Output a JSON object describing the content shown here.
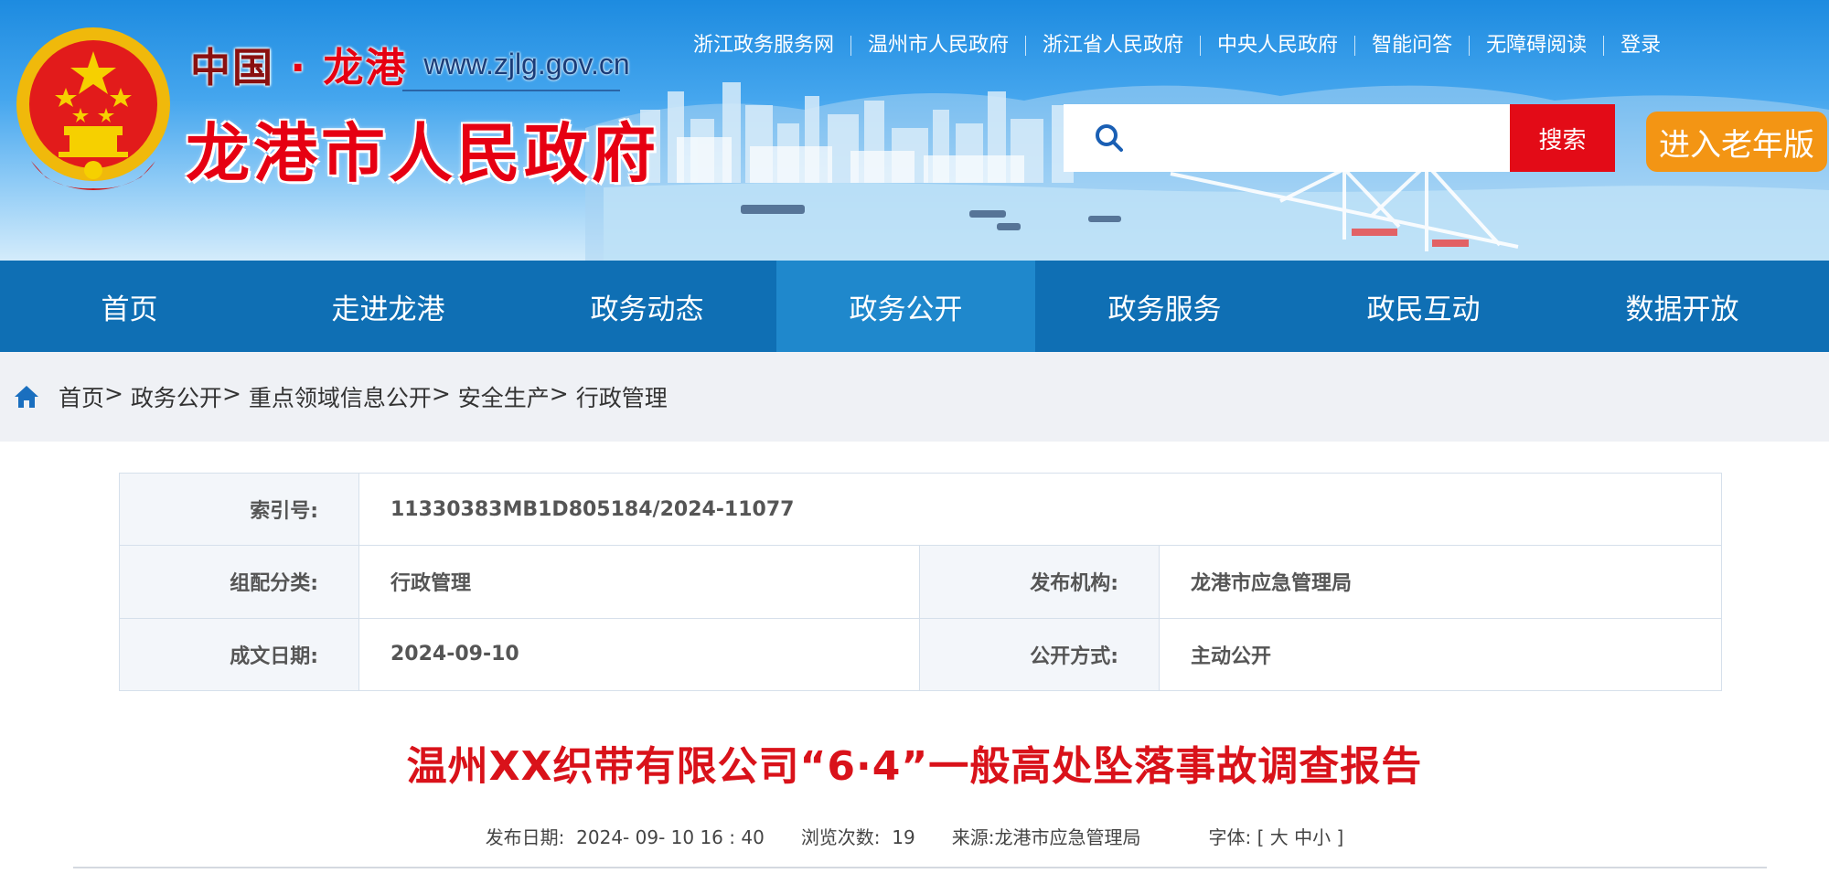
{
  "header": {
    "brand_cn_left": "中国",
    "brand_dot": "·",
    "brand_cn_right": "龙港",
    "brand_url": "www.zjlg.gov.cn",
    "site_title": "龙港市人民政府",
    "top_links": [
      "浙江政务服务网",
      "温州市人民政府",
      "浙江省人民政府",
      "中央人民政府",
      "智能问答",
      "无障碍阅读",
      "登录"
    ],
    "search": {
      "placeholder": "",
      "button_label": "搜索"
    },
    "elder_mode_label": "进入老年版"
  },
  "nav": {
    "items": [
      "首页",
      "走进龙港",
      "政务动态",
      "政务公开",
      "政务服务",
      "政民互动",
      "数据开放"
    ],
    "active_index": 3
  },
  "breadcrumb": [
    "首页",
    "政务公开",
    "重点领域信息公开",
    "安全生产",
    "行政管理"
  ],
  "info": {
    "index_label": "索引号:",
    "index_value": "11330383MB1D805184/2024-11077",
    "category_label": "组配分类:",
    "category_value": "行政管理",
    "publisher_label": "发布机构:",
    "publisher_value": "龙港市应急管理局",
    "date_label": "成文日期:",
    "date_value": "2024-09-10",
    "method_label": "公开方式:",
    "method_value": "主动公开"
  },
  "article": {
    "title": "温州XX织带有限公司“6·4”一般高处坠落事故调查报告",
    "publish_label": "发布日期:",
    "publish_value": "2024- 09- 10 16 : 40",
    "views_label": "浏览次数:",
    "views_value": "19",
    "source_label": "来源:",
    "source_value": "龙港市应急管理局",
    "font_label": "字体:",
    "font_open": "[",
    "font_large": "大",
    "font_medium": "中",
    "font_small": "小",
    "font_close": "]"
  },
  "colors": {
    "nav_bg": "#0f6fb4",
    "nav_active": "#1f88cc",
    "search_button": "#e30b17",
    "elder_button": "#f39514",
    "title_red": "#d9121a"
  }
}
